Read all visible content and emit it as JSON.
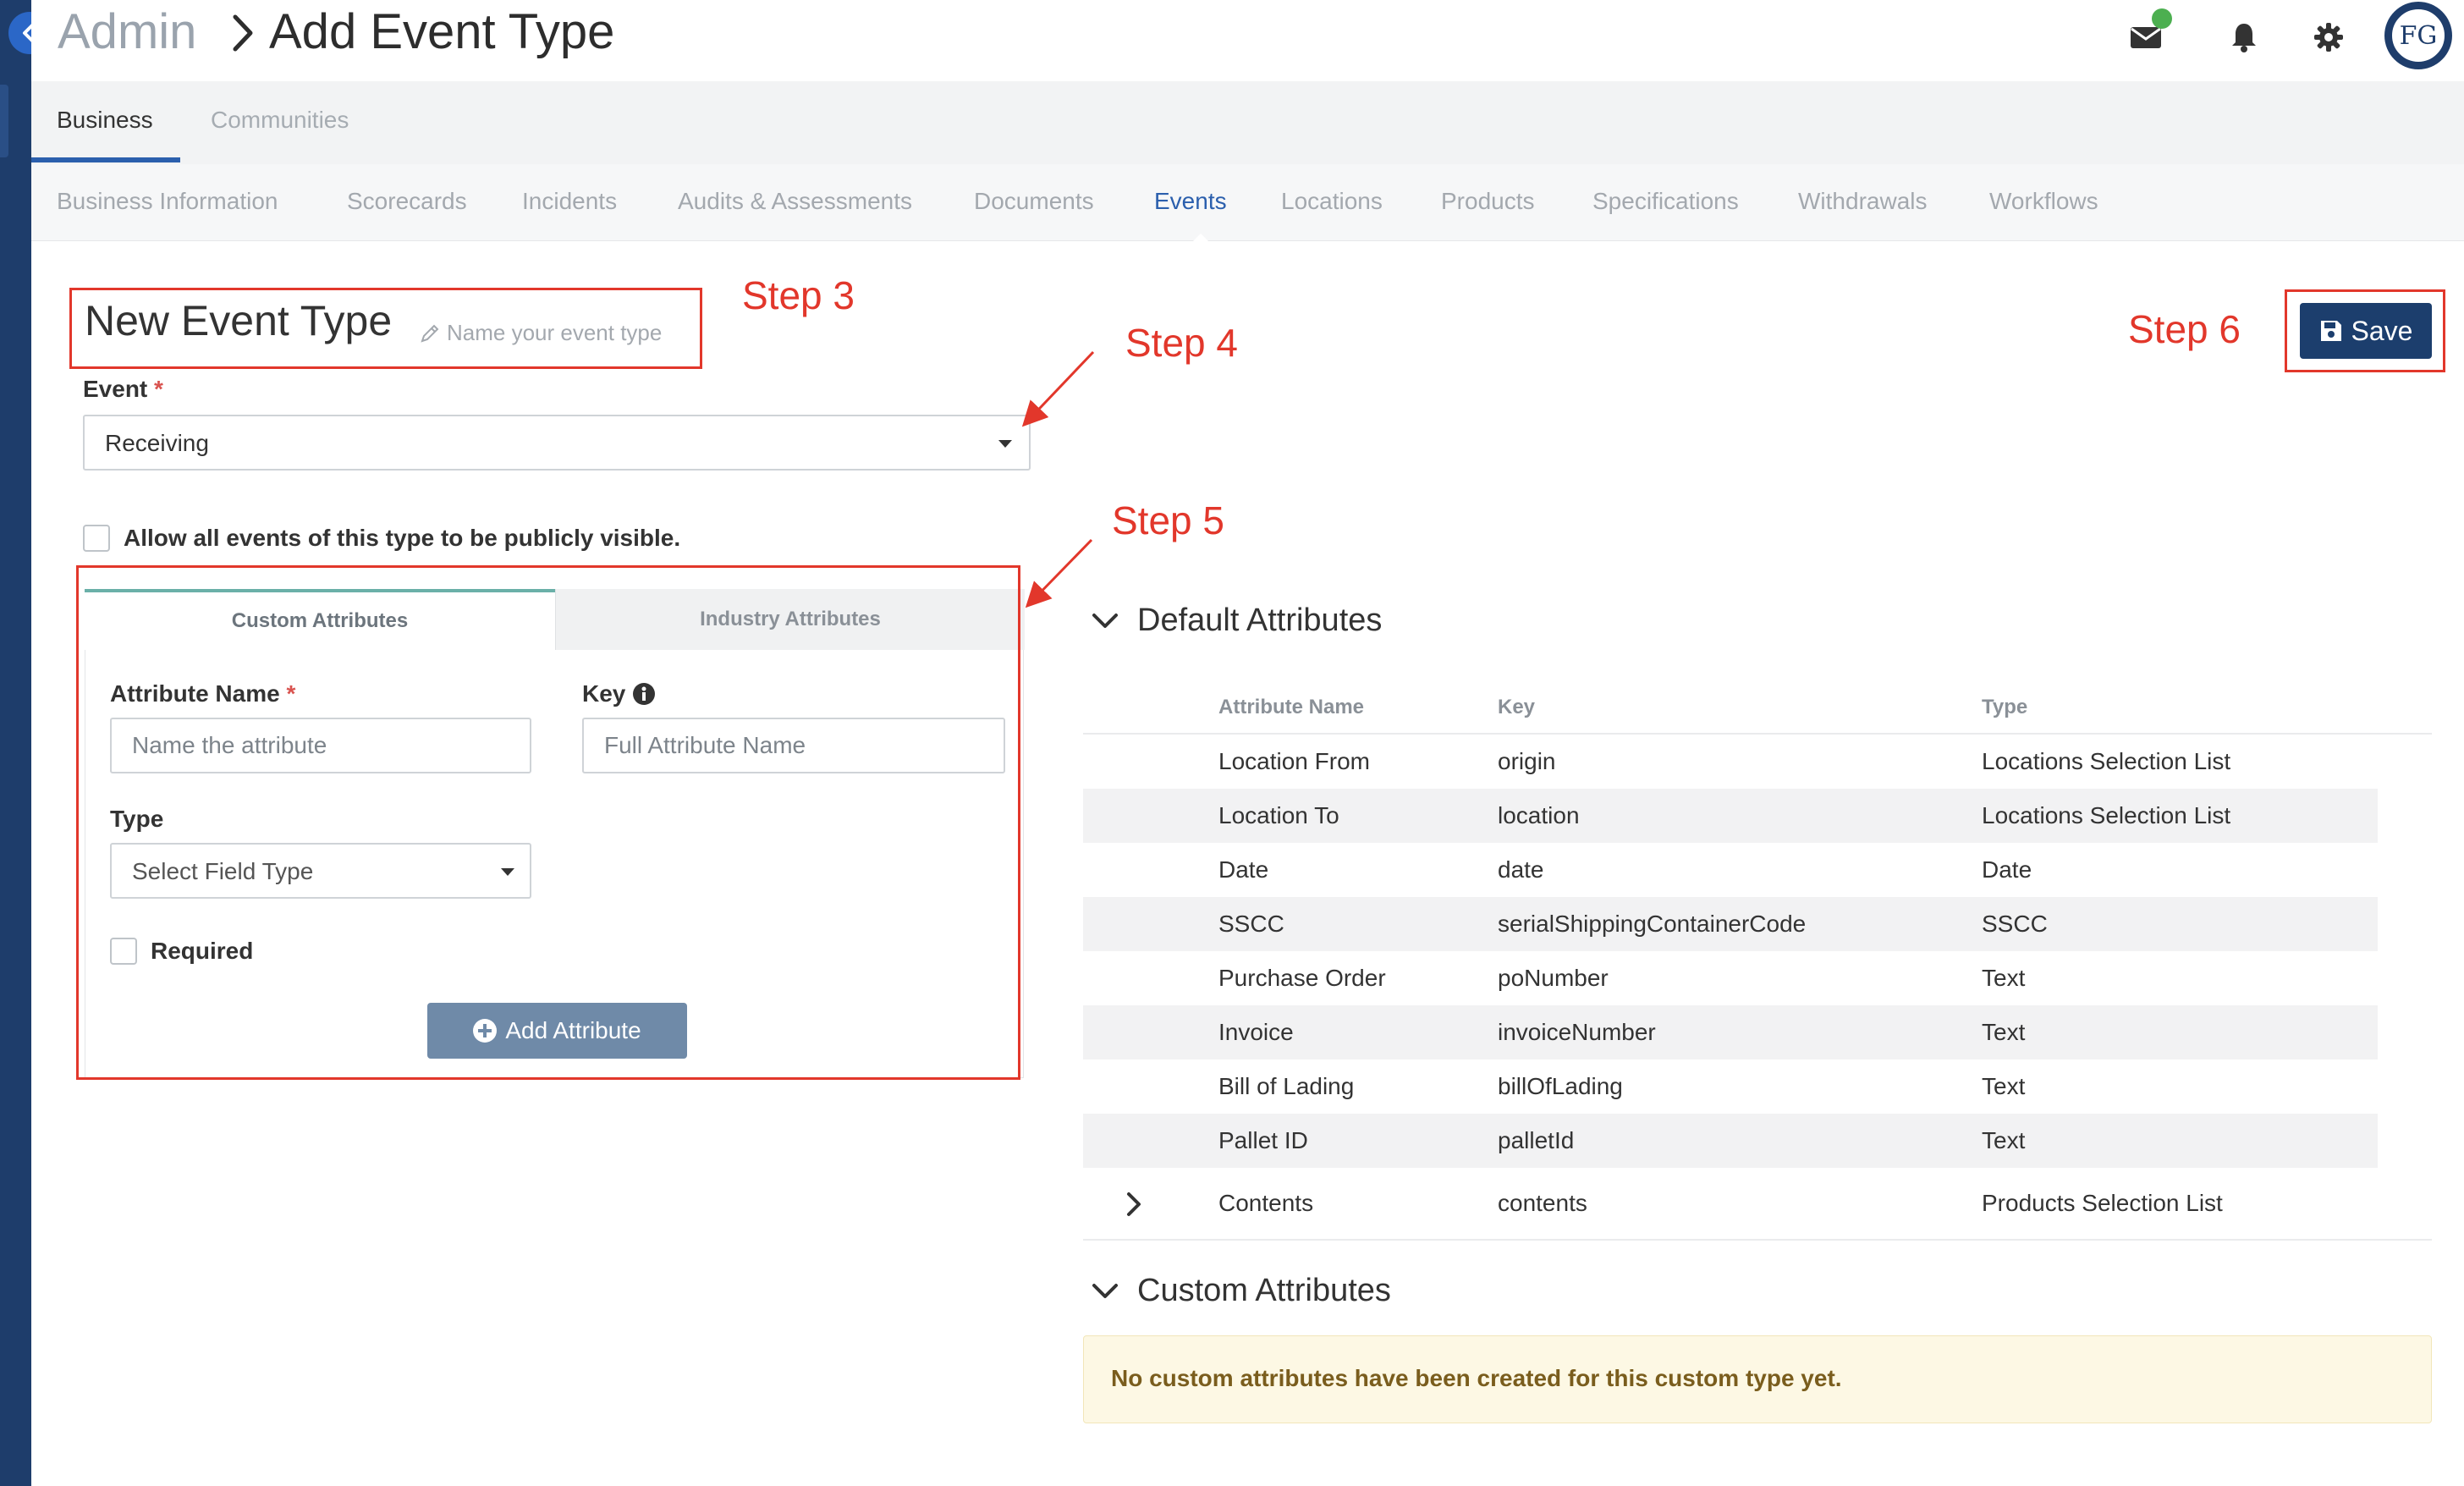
{
  "header": {
    "breadcrumb_parent": "Admin",
    "page_title": "Add Event Type",
    "avatar_initials": "FG"
  },
  "primary_tabs": [
    {
      "label": "Business",
      "active": true
    },
    {
      "label": "Communities",
      "active": false
    }
  ],
  "secondary_tabs": [
    {
      "label": "Business Information"
    },
    {
      "label": "Scorecards"
    },
    {
      "label": "Incidents"
    },
    {
      "label": "Audits & Assessments"
    },
    {
      "label": "Documents"
    },
    {
      "label": "Events",
      "active": true
    },
    {
      "label": "Locations"
    },
    {
      "label": "Products"
    },
    {
      "label": "Specifications"
    },
    {
      "label": "Withdrawals"
    },
    {
      "label": "Workflows"
    }
  ],
  "form": {
    "name_title": "New Event Type",
    "name_hint": "Name your event type",
    "event_label": "Event",
    "required_mark": "*",
    "event_value": "Receiving",
    "public_checkbox_label": "Allow all events of this type to be publicly visible.",
    "public_checked": false
  },
  "attribute_editor": {
    "tab_custom": "Custom Attributes",
    "tab_industry": "Industry Attributes",
    "attr_name_label": "Attribute Name",
    "attr_name_placeholder": "Name the attribute",
    "key_label": "Key",
    "key_placeholder": "Full Attribute Name",
    "type_label": "Type",
    "type_placeholder": "Select Field Type",
    "required_label": "Required",
    "required_checked": false,
    "add_button": "Add Attribute"
  },
  "save_button": "Save",
  "default_attributes": {
    "heading": "Default Attributes",
    "columns": [
      "Attribute Name",
      "Key",
      "Type"
    ],
    "rows": [
      {
        "name": "Location From",
        "key": "origin",
        "type": "Locations Selection List"
      },
      {
        "name": "Location To",
        "key": "location",
        "type": "Locations Selection List"
      },
      {
        "name": "Date",
        "key": "date",
        "type": "Date"
      },
      {
        "name": "SSCC",
        "key": "serialShippingContainerCode",
        "type": "SSCC"
      },
      {
        "name": "Purchase Order",
        "key": "poNumber",
        "type": "Text"
      },
      {
        "name": "Invoice",
        "key": "invoiceNumber",
        "type": "Text"
      },
      {
        "name": "Bill of Lading",
        "key": "billOfLading",
        "type": "Text"
      },
      {
        "name": "Pallet ID",
        "key": "palletId",
        "type": "Text"
      },
      {
        "name": "Contents",
        "key": "contents",
        "type": "Products Selection List"
      }
    ]
  },
  "custom_attributes": {
    "heading": "Custom Attributes",
    "empty_message": "No custom attributes have been created for this custom type yet."
  },
  "annotations": {
    "step3": "Step 3",
    "step4": "Step 4",
    "step5": "Step 5",
    "step6": "Step 6",
    "color": "#e2372b"
  },
  "colors": {
    "sidebar": "#1e3d6b",
    "accent": "#2b5fad",
    "save_button": "#1c3e6d",
    "notification_dot": "#4caf50"
  }
}
